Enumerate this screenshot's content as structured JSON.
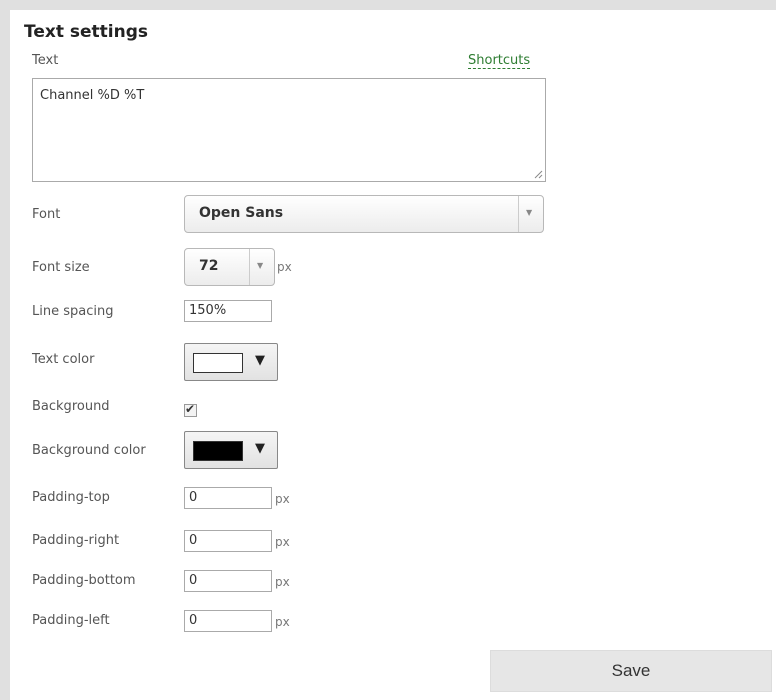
{
  "panel": {
    "title": "Text settings",
    "text_label": "Text",
    "shortcuts_link": "Shortcuts",
    "text_value": "Channel %D %T"
  },
  "font": {
    "label": "Font",
    "value": "Open Sans"
  },
  "font_size": {
    "label": "Font size",
    "value": "72",
    "unit": "px"
  },
  "line_spacing": {
    "label": "Line spacing",
    "value": "150%"
  },
  "text_color": {
    "label": "Text color",
    "color": "#ffffff"
  },
  "background": {
    "label": "Background",
    "checked": true
  },
  "background_color": {
    "label": "Background color",
    "color": "#000000"
  },
  "padding": [
    {
      "label": "Padding-top",
      "value": "0",
      "unit": "px"
    },
    {
      "label": "Padding-right",
      "value": "0",
      "unit": "px"
    },
    {
      "label": "Padding-bottom",
      "value": "0",
      "unit": "px"
    },
    {
      "label": "Padding-left",
      "value": "0",
      "unit": "px"
    }
  ],
  "actions": {
    "save_label": "Save"
  },
  "icons": {
    "dropdown": "chevron-down-icon",
    "color_picker": "caret-down-icon",
    "check": "check-icon"
  }
}
